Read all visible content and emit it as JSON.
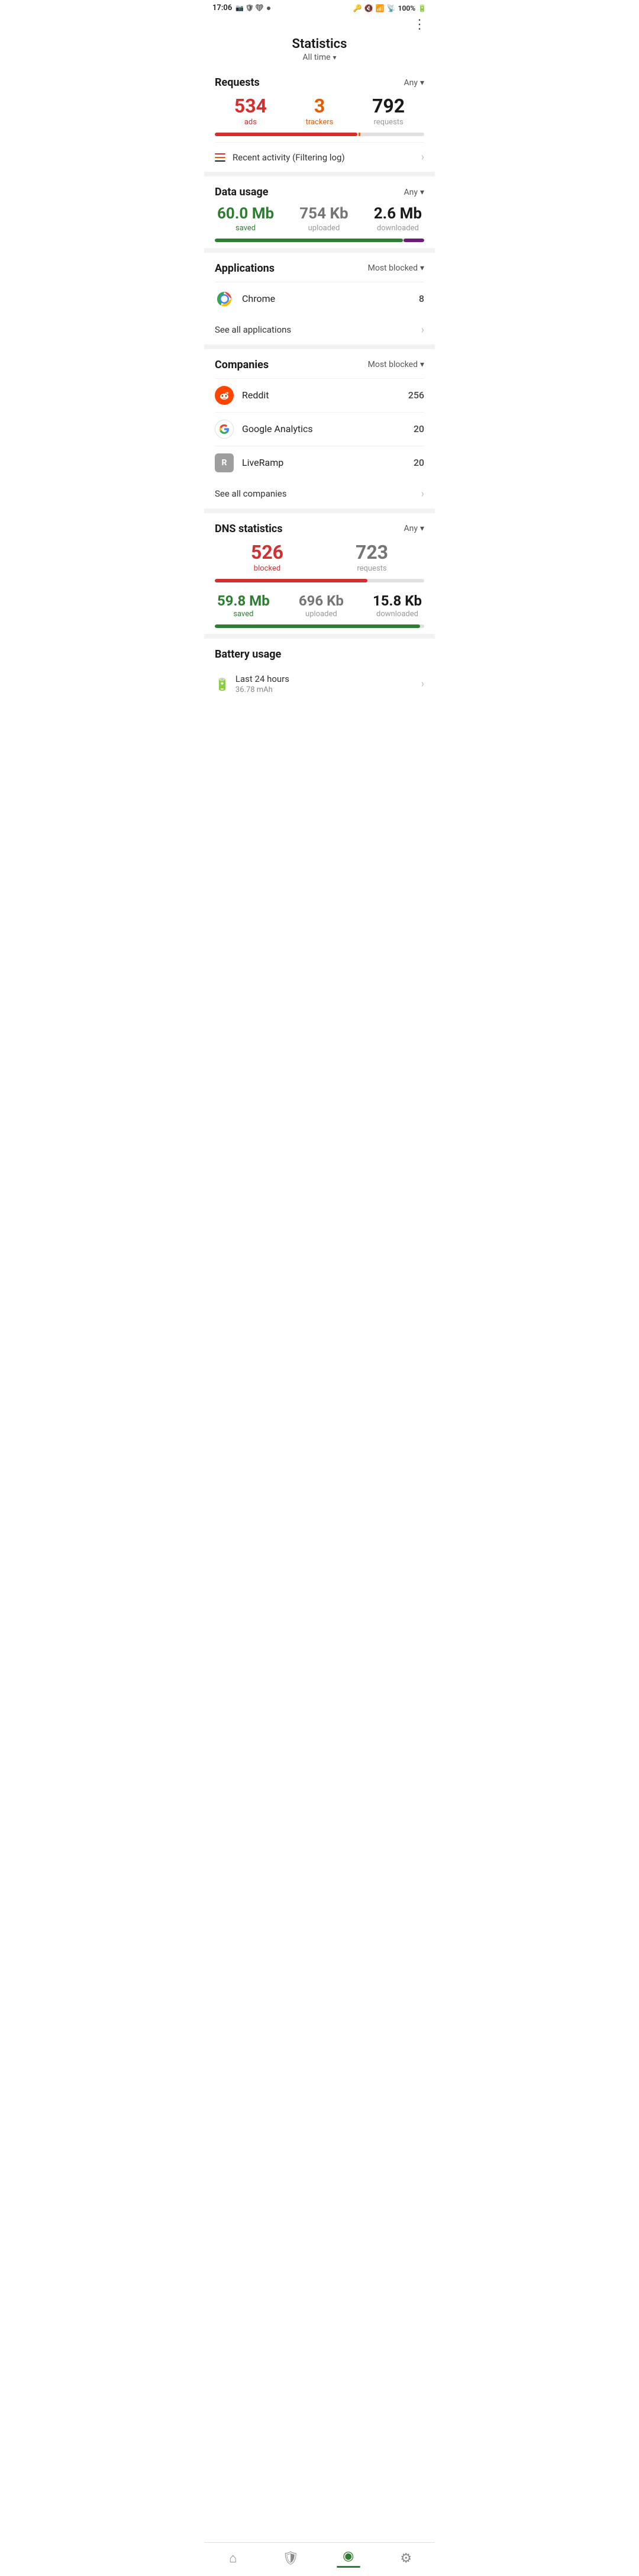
{
  "statusBar": {
    "time": "17:06",
    "battery": "100%"
  },
  "header": {
    "title": "Statistics",
    "subtitle": "All time",
    "menuLabel": "⋮"
  },
  "requests": {
    "sectionTitle": "Requests",
    "filter": "Any",
    "ads": {
      "value": "534",
      "label": "ads"
    },
    "trackers": {
      "value": "3",
      "label": "trackers"
    },
    "total": {
      "value": "792",
      "label": "requests"
    },
    "progressAds": 68,
    "progressTrackers": 1
  },
  "recentActivity": {
    "label": "Recent activity (Filtering log)"
  },
  "dataUsage": {
    "sectionTitle": "Data usage",
    "filter": "Any",
    "saved": {
      "value": "60.0 Mb",
      "label": "saved"
    },
    "uploaded": {
      "value": "754 Kb",
      "label": "uploaded"
    },
    "downloaded": {
      "value": "2.6 Mb",
      "label": "downloaded"
    },
    "progressSaved": 90
  },
  "applications": {
    "sectionTitle": "Applications",
    "filter": "Most blocked",
    "items": [
      {
        "name": "Chrome",
        "count": "8",
        "iconType": "chrome"
      }
    ],
    "seeAll": "See all applications"
  },
  "companies": {
    "sectionTitle": "Companies",
    "filter": "Most blocked",
    "items": [
      {
        "name": "Reddit",
        "count": "256",
        "iconType": "reddit"
      },
      {
        "name": "Google Analytics",
        "count": "20",
        "iconType": "google"
      },
      {
        "name": "LiveRamp",
        "count": "20",
        "iconType": "liveramp"
      }
    ],
    "seeAll": "See all companies"
  },
  "dnsStats": {
    "sectionTitle": "DNS statistics",
    "filter": "Any",
    "blocked": {
      "value": "526",
      "label": "blocked"
    },
    "requests": {
      "value": "723",
      "label": "requests"
    },
    "progressBlocked": 73,
    "saved": {
      "value": "59.8 Mb",
      "label": "saved"
    },
    "uploaded": {
      "value": "696 Kb",
      "label": "uploaded"
    },
    "downloaded": {
      "value": "15.8 Kb",
      "label": "downloaded"
    },
    "progressSaved": 98
  },
  "battery": {
    "sectionTitle": "Battery usage",
    "rowLabel": "Last 24 hours",
    "rowValue": "36.78 mAh"
  },
  "bottomNav": {
    "items": [
      {
        "icon": "home",
        "label": "home",
        "active": false
      },
      {
        "icon": "shield",
        "label": "shield",
        "active": false
      },
      {
        "icon": "chart",
        "label": "statistics",
        "active": true
      },
      {
        "icon": "settings",
        "label": "settings",
        "active": false
      }
    ]
  }
}
